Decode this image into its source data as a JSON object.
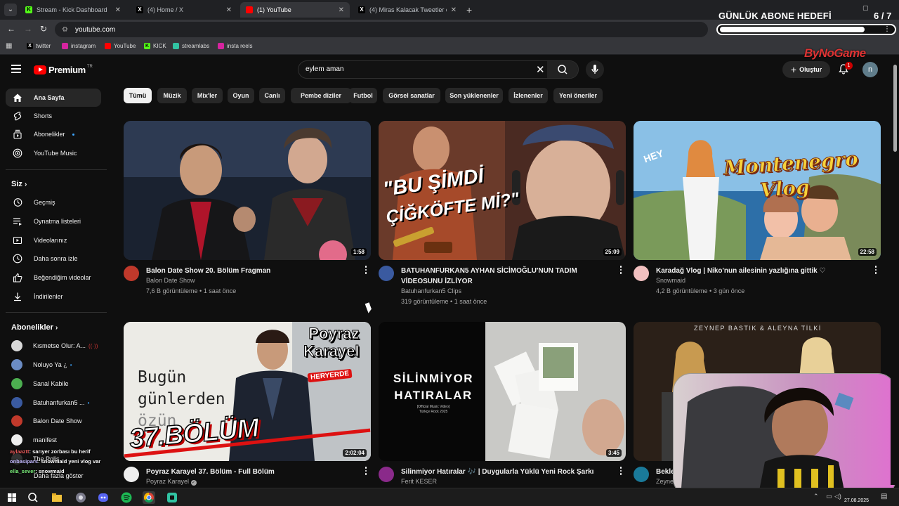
{
  "browser": {
    "tabs": [
      {
        "title": "Stream - Kick Dashboard",
        "active": false
      },
      {
        "title": "(4) Home / X",
        "active": false
      },
      {
        "title": "(1) YouTube",
        "active": true
      },
      {
        "title": "(4) Miras Kalacak Tweetler on X",
        "active": false
      }
    ],
    "url": "youtube.com",
    "bookmarks": [
      "twitter",
      "instagram",
      "YouTube",
      "KICK",
      "streamlabs",
      "insta reels"
    ]
  },
  "overlay": {
    "goal_title": "GÜNLÜK ABONE HEDEFİ",
    "goal_count": "6 / 7",
    "goal_progress": 0.86,
    "brand": "ByNoGame"
  },
  "header": {
    "logo_word": "Premium",
    "logo_region": "TR",
    "search_query": "eylem aman",
    "create_label": "Oluştur",
    "notification_count": "1",
    "avatar_letter": "n"
  },
  "sidebar": {
    "main": [
      {
        "label": "Ana Sayfa",
        "icon": "home-icon",
        "active": true
      },
      {
        "label": "Shorts",
        "icon": "shorts-icon"
      },
      {
        "label": "Abonelikler",
        "icon": "subscriptions-icon",
        "dot": true
      },
      {
        "label": "YouTube Music",
        "icon": "music-icon"
      }
    ],
    "you_heading": "Siz",
    "you": [
      {
        "label": "Geçmiş",
        "icon": "history-icon"
      },
      {
        "label": "Oynatma listeleri",
        "icon": "playlist-icon"
      },
      {
        "label": "Videolarınız",
        "icon": "your-videos-icon"
      },
      {
        "label": "Daha sonra izle",
        "icon": "watch-later-icon"
      },
      {
        "label": "Beğendiğim videolar",
        "icon": "like-icon"
      },
      {
        "label": "İndirilenler",
        "icon": "download-icon"
      }
    ],
    "subs_heading": "Abonelikler",
    "subscriptions": [
      {
        "name": "Kısmetse Olur: A...",
        "indicator": "((·))",
        "color": "#d8d8d8"
      },
      {
        "name": "Noluyo Ya ¿",
        "indicator": "•",
        "color": "#6b8cc4"
      },
      {
        "name": "Sanal Kabile",
        "indicator": "",
        "color": "#4caf50"
      },
      {
        "name": "Batuhanfurkan5 ...",
        "indicator": "•",
        "color": "#3a5aa0"
      },
      {
        "name": "Balon Date Show",
        "indicator": "",
        "color": "#c0392b"
      },
      {
        "name": "manifest",
        "indicator": "",
        "color": "#eeeeee"
      },
      {
        "name": "The Polis",
        "indicator": "",
        "color": "#333333"
      }
    ],
    "show_more": "Daha fazla göster"
  },
  "chat": [
    {
      "user": "aylaaztt",
      "msg": ": sarıyer zorbası bu herif"
    },
    {
      "user": "onbasipars",
      "msg": ": snowmaid yeni vlog var"
    },
    {
      "user": "ella_sever",
      "msg": ": snowmaid"
    }
  ],
  "chips": [
    "Tümü",
    "Müzik",
    "Mix'ler",
    "Oyun",
    "Canlı",
    "Pembe diziler",
    "Futbol",
    "Görsel sanatlar",
    "Son yüklenenler",
    "İzlenenler",
    "Yeni öneriler"
  ],
  "videos": [
    {
      "title": "Balon Date Show 20. Bölüm Fragman",
      "channel": "Balon Date Show",
      "meta": "7,6 B görüntüleme • 1 saat önce",
      "duration": "1:58",
      "verified": false
    },
    {
      "title": "BATUHANFURKAN5 AYHAN SİCİMOĞLU'NUN TADIM VİDEOSUNU İZLİYOR",
      "channel": "Batuhanfurkan5 Clips",
      "meta": "319 görüntüleme • 1 saat önce",
      "duration": "25:09",
      "verified": false
    },
    {
      "title": "Karadağ Vlog | Niko'nun ailesinin yazlığına gittik ♡",
      "channel": "Snowmaid",
      "meta": "4,2 B görüntüleme • 3 gün önce",
      "duration": "22:58",
      "verified": false
    },
    {
      "title": "Poyraz Karayel 37. Bölüm - Full Bölüm",
      "channel": "Poyraz Karayel",
      "meta": "",
      "duration": "2:02:04",
      "verified": true
    },
    {
      "title": "Silinmiyor Hatıralar 🎶 | Duygularla Yüklü Yeni Rock Şarkı",
      "channel": "Ferit KESER",
      "meta": "",
      "duration": "3:45",
      "verified": false
    },
    {
      "title": "Bekle",
      "channel": "Zeynep",
      "meta": "",
      "duration": "",
      "verified": false
    }
  ],
  "thumb_text": {
    "v2_line1": "\"BU ŞİMDİ",
    "v2_line2": "ÇİĞKÖFTE Mİ?\"",
    "v3_line1": "Montenegro",
    "v3_line2": "Vlog",
    "v3_hey": "HEY",
    "v4_title1": "Poyraz",
    "v4_title2": "Karayel",
    "v4_board1": "Bugün",
    "v4_board2": "günlerden",
    "v4_board3": "özün",
    "v4_badge": "HERYERDE",
    "v4_episode": "37.BÖLÜM",
    "v5_line1": "SİLİNMİYOR",
    "v5_line2": "HATIRALAR",
    "v5_sub1": "[Official Music Video]",
    "v5_sub2": "Türkçe Rock 2025",
    "v6_caption": "ZEYNEP BASTIK & ALEYNA TİLKİ"
  },
  "taskbar": {
    "date": "27.08.2025"
  },
  "colors": {
    "accent_red": "#ff0000",
    "chip_active_bg": "#f1f1f1",
    "background": "#0f0f0f"
  }
}
